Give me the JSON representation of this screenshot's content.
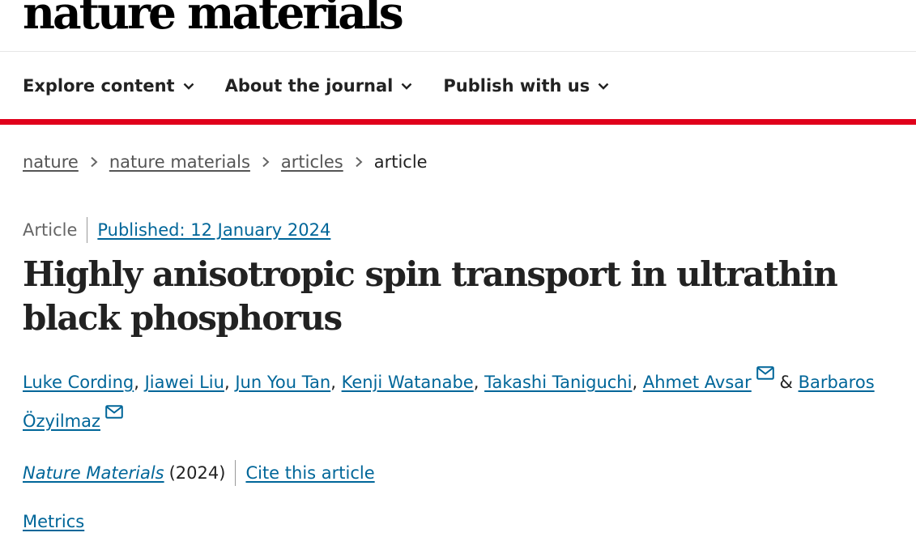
{
  "logo": {
    "text": "nature materials"
  },
  "nav": {
    "items": [
      {
        "label": "Explore content"
      },
      {
        "label": "About the journal"
      },
      {
        "label": "Publish with us"
      }
    ]
  },
  "breadcrumb": {
    "items": [
      {
        "label": "nature"
      },
      {
        "label": "nature materials"
      },
      {
        "label": "articles"
      }
    ],
    "current": "article"
  },
  "article": {
    "type": "Article",
    "published": "Published: 12 January 2024",
    "title": "Highly anisotropic spin transport in ultrathin black phosphorus",
    "authors": [
      {
        "name": "Luke Cording"
      },
      {
        "name": "Jiawei Liu"
      },
      {
        "name": "Jun You Tan"
      },
      {
        "name": "Kenji Watanabe"
      },
      {
        "name": "Takashi Taniguchi"
      },
      {
        "name": "Ahmet Avsar"
      },
      {
        "name": "Barbaros Özyilmaz"
      }
    ],
    "author_separator": ",",
    "author_conjunction": "&",
    "journal": "Nature Materials",
    "year": "(2024)",
    "cite_label": "Cite this article",
    "metrics_label": "Metrics"
  },
  "colors": {
    "accent_red": "#e0001b",
    "link_blue": "#006699",
    "text": "#222222"
  },
  "icons": {
    "nav_chevron": "chevron-down-icon",
    "breadcrumb_separator": "chevron-right-icon",
    "author_contact": "mail-icon"
  }
}
